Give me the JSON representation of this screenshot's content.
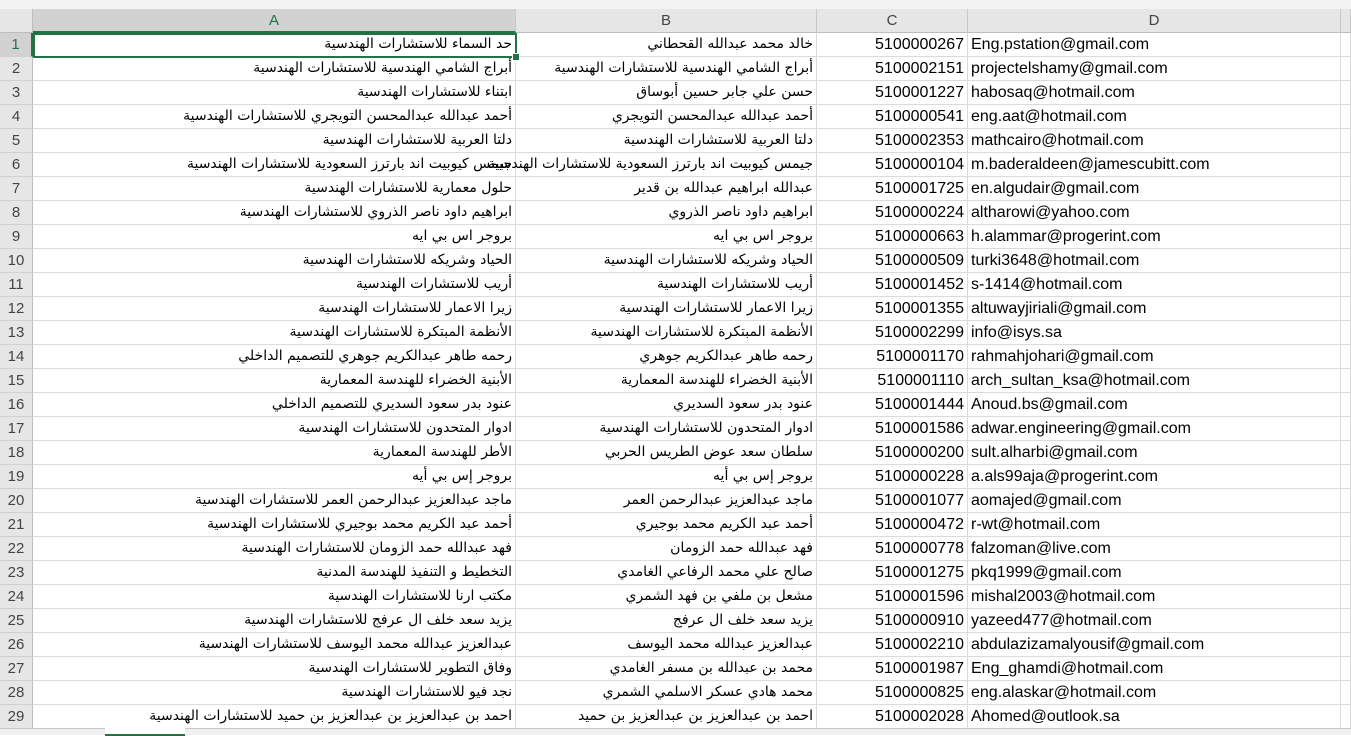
{
  "columns": [
    "A",
    "B",
    "C",
    "D"
  ],
  "selected_cell": "A1",
  "rows": [
    {
      "n": "1",
      "a": "حد السماء للاستشارات الهندسية",
      "b": "خالد محمد عبدالله القحطاني",
      "c": "5100000267",
      "d": "Eng.pstation@gmail.com"
    },
    {
      "n": "2",
      "a": "أبراج الشامي الهندسية للاستشارات الهندسية",
      "b": "أبراج الشامي الهندسية للاستشارات الهندسية",
      "c": "5100002151",
      "d": "projectelshamy@gmail.com"
    },
    {
      "n": "3",
      "a": "ابتناء للاستشارات الهندسية",
      "b": "حسن علي جابر حسين أبوساق",
      "c": "5100001227",
      "d": "habosaq@hotmail.com"
    },
    {
      "n": "4",
      "a": "أحمد عبدالله عبدالمحسن التويجري للاستشارات الهندسية",
      "b": "أحمد عبدالله عبدالمحسن التويجري",
      "c": "5100000541",
      "d": "eng.aat@hotmail.com"
    },
    {
      "n": "5",
      "a": "دلتا العربية للاستشارات الهندسية",
      "b": "دلتا العربية للاستشارات الهندسية",
      "c": "5100002353",
      "d": "mathcairo@hotmail.com"
    },
    {
      "n": "6",
      "a": "جيمس كيوبيت اند بارترز السعودية للاستشارات الهندسية",
      "b": "جيمس كيوبيت اند بارترز السعودية للاستشارات الهندسية",
      "c": "5100000104",
      "d": "m.baderaldeen@jamescubitt.com"
    },
    {
      "n": "7",
      "a": "حلول معمارية للاستشارات الهندسية",
      "b": "عبدالله ابراهيم عبدالله بن قدير",
      "c": "5100001725",
      "d": "en.algudair@gmail.com"
    },
    {
      "n": "8",
      "a": "ابراهيم داود ناصر الذروي للاستشارات الهندسية",
      "b": "ابراهيم داود ناصر الذروي",
      "c": "5100000224",
      "d": "altharowi@yahoo.com"
    },
    {
      "n": "9",
      "a": "بروجر اس بي ايه",
      "b": "بروجر اس بي ايه",
      "c": "5100000663",
      "d": "h.alammar@progerint.com"
    },
    {
      "n": "10",
      "a": "الحياد وشريكه للاستشارات الهندسية",
      "b": "الحياد وشريكه للاستشارات الهندسية",
      "c": "5100000509",
      "d": "turki3648@hotmail.com"
    },
    {
      "n": "11",
      "a": "أريب للاستشارات الهندسية",
      "b": "أريب للاستشارات الهندسية",
      "c": "5100001452",
      "d": "s-1414@hotmail.com"
    },
    {
      "n": "12",
      "a": "زيرا الاعمار للاستشارات الهندسية",
      "b": "زيرا الاعمار للاستشارات الهندسية",
      "c": "5100001355",
      "d": "altuwayjiriali@gmail.com"
    },
    {
      "n": "13",
      "a": "الأنظمة المبتكرة للاستشارات الهندسية",
      "b": "الأنظمة المبتكرة للاستشارات الهندسية",
      "c": "5100002299",
      "d": "info@isys.sa"
    },
    {
      "n": "14",
      "a": "رحمه طاهر عبدالكريم جوهري للتصميم الداخلي",
      "b": "رحمه طاهر عبدالكريم جوهري",
      "c": "5100001170",
      "d": "rahmahjohari@gmail.com"
    },
    {
      "n": "15",
      "a": "الأبنية الخضراء للهندسة المعمارية",
      "b": "الأبنية الخضراء للهندسة المعمارية",
      "c": "5100001110",
      "d": "arch_sultan_ksa@hotmail.com"
    },
    {
      "n": "16",
      "a": "عنود بدر سعود السديري للتصميم الداخلي",
      "b": "عنود بدر سعود السديري",
      "c": "5100001444",
      "d": "Anoud.bs@gmail.com"
    },
    {
      "n": "17",
      "a": "ادوار المتحدون للاستشارات الهندسية",
      "b": "ادوار المتحدون للاستشارات الهندسية",
      "c": "5100001586",
      "d": "adwar.engineering@gmail.com"
    },
    {
      "n": "18",
      "a": "الأطر للهندسة المعمارية",
      "b": "سلطان سعد عوض الطريس الحربي",
      "c": "5100000200",
      "d": "sult.alharbi@gmail.com"
    },
    {
      "n": "19",
      "a": "بروجر إس بي أيه",
      "b": "بروجر إس بي أيه",
      "c": "5100000228",
      "d": "a.als99aja@progerint.com"
    },
    {
      "n": "20",
      "a": "ماجد عبدالعزيز عبدالرحمن العمر للاستشارات الهندسية",
      "b": "ماجد عبدالعزيز عبدالرحمن العمر",
      "c": "5100001077",
      "d": "aomajed@gmail.com"
    },
    {
      "n": "21",
      "a": "أحمد عبد الكريم محمد بوجيري للاستشارات الهندسية",
      "b": "أحمد عبد الكريم محمد بوجيري",
      "c": "5100000472",
      "d": "r-wt@hotmail.com"
    },
    {
      "n": "22",
      "a": "فهد عبدالله حمد الزومان للاستشارات الهندسية",
      "b": "فهد عبدالله حمد الزومان",
      "c": "5100000778",
      "d": "falzoman@live.com"
    },
    {
      "n": "23",
      "a": "التخطيط و التنفيذ للهندسة المدنية",
      "b": "صالح علي محمد الرفاعي الغامدي",
      "c": "5100001275",
      "d": "pkq1999@gmail.com"
    },
    {
      "n": "24",
      "a": "مكتب ارنا للاستشارات الهندسية",
      "b": "مشعل بن ملفي بن فهد الشمري",
      "c": "5100001596",
      "d": "mishal2003@hotmail.com"
    },
    {
      "n": "25",
      "a": "يزيد سعد خلف ال عرفج للاستشارات الهندسية",
      "b": "يزيد سعد خلف ال عرفج",
      "c": "5100000910",
      "d": "yazeed477@hotmail.com"
    },
    {
      "n": "26",
      "a": "عبدالعزيز عبدالله محمد اليوسف للاستشارات الهندسية",
      "b": "عبدالعزيز عبدالله محمد اليوسف",
      "c": "5100002210",
      "d": "abdulazizamalyousif@gmail.com"
    },
    {
      "n": "27",
      "a": "وفاق التطوير للاستشارات الهندسية",
      "b": "محمد بن عبدالله بن مسفر الغامدي",
      "c": "5100001987",
      "d": "Eng_ghamdi@hotmail.com"
    },
    {
      "n": "28",
      "a": "نجد فيو للاستشارات الهندسية",
      "b": "محمد هادي عسكر الاسلمي الشمري",
      "c": "5100000825",
      "d": "eng.alaskar@hotmail.com"
    },
    {
      "n": "29",
      "a": "احمد بن عبدالعزيز بن عبدالعزيز بن حميد للاستشارات الهندسية",
      "b": "احمد بن عبدالعزيز بن عبدالعزيز بن حميد",
      "c": "5100002028",
      "d": "Ahomed@outlook.sa"
    }
  ]
}
